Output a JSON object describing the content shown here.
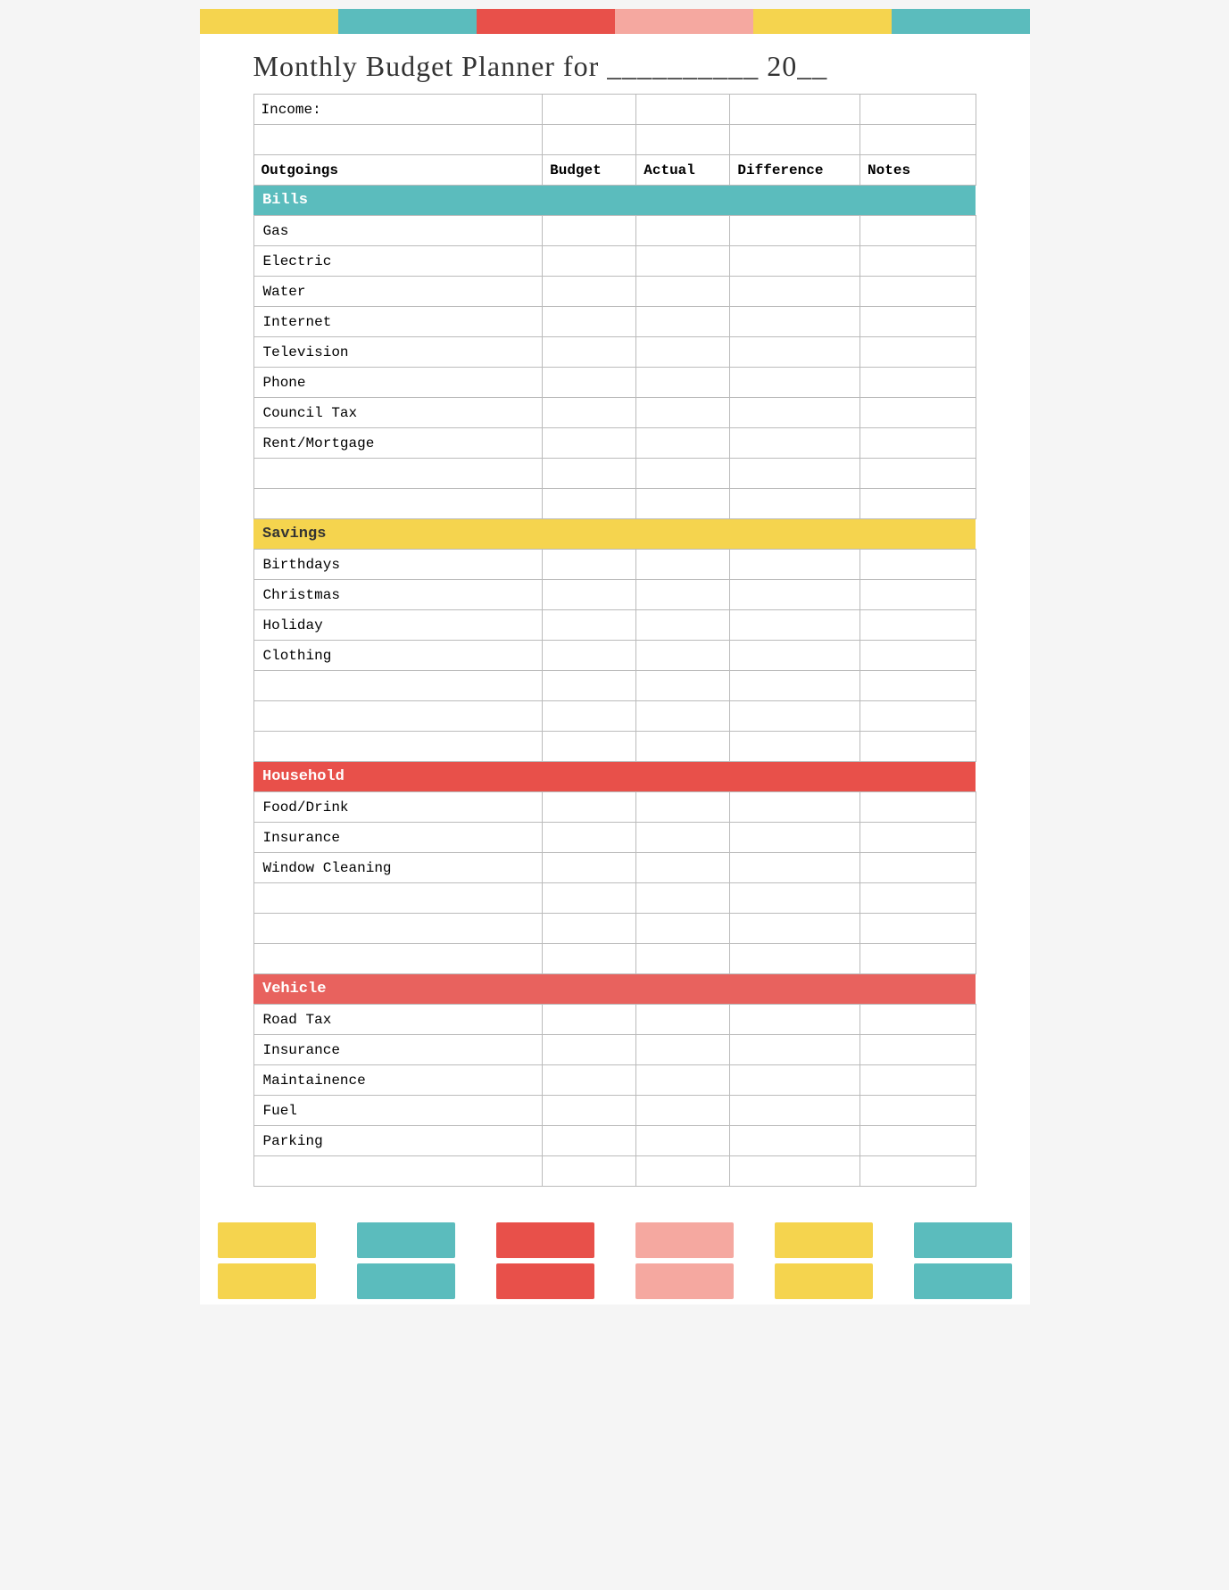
{
  "colorStrip": {
    "top": [
      "#f5d44e",
      "#f5d44e",
      "#5bbcbd",
      "#5bbcbd",
      "#e8504a",
      "#e8504a",
      "#f5a8a0",
      "#f5a8a0",
      "#f5d44e",
      "#f5d44e",
      "#5bbcbd",
      "#5bbcbd"
    ],
    "bottom1": [
      "#f5d44e",
      "#5bbcbd",
      "#e8504a",
      "#f5a8a0",
      "#f5d44e",
      "#5bbcbd"
    ],
    "bottom2": [
      "#f5d44e",
      "#5bbcbd",
      "#e8504a",
      "#f5a8a0",
      "#f5d44e",
      "#5bbcbd"
    ]
  },
  "title": "Monthly Budget Planner for __________ 20__",
  "header": {
    "col1": "Outgoings",
    "col2": "Budget",
    "col3": "Actual",
    "col4": "Difference",
    "col5": "Notes"
  },
  "income_label": "Income:",
  "sections": {
    "bills": {
      "label": "Bills",
      "rows": [
        "Gas",
        "Electric",
        "Water",
        "Internet",
        "Television",
        "Phone",
        "Council Tax",
        "Rent/Mortgage",
        "",
        ""
      ]
    },
    "savings": {
      "label": "Savings",
      "rows": [
        "Birthdays",
        "Christmas",
        "Holiday",
        "Clothing",
        "",
        "",
        ""
      ]
    },
    "household": {
      "label": "Household",
      "rows": [
        "Food/Drink",
        "Insurance",
        "Window Cleaning",
        "",
        "",
        ""
      ]
    },
    "vehicle": {
      "label": "Vehicle",
      "rows": [
        "Road Tax",
        "Insurance",
        "Maintainence",
        "Fuel",
        "Parking",
        ""
      ]
    }
  }
}
